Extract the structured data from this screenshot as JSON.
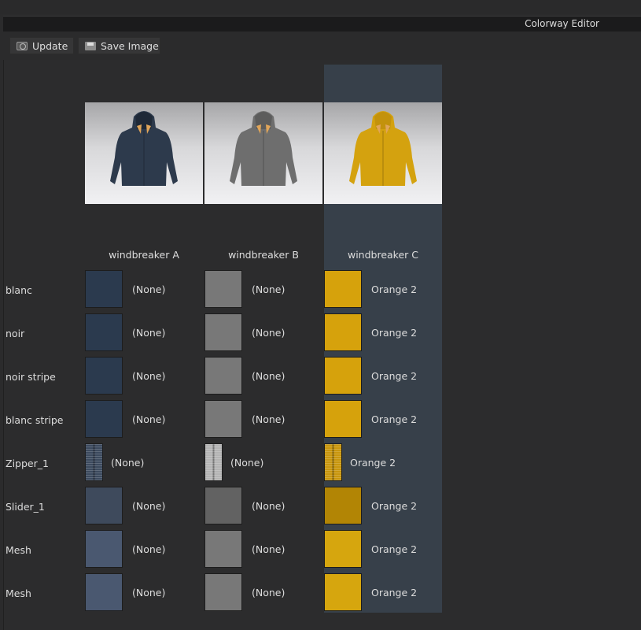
{
  "window": {
    "title": "Colorway Editor"
  },
  "toolbar": {
    "update_label": "Update",
    "save_label": "Save Image"
  },
  "colorways": [
    {
      "name": "windbreaker A",
      "jacket_color": "#2d3a4c",
      "hood_color": "#1f2937"
    },
    {
      "name": "windbreaker B",
      "jacket_color": "#6e6e6e",
      "hood_color": "#5c5c5c"
    },
    {
      "name": "windbreaker C",
      "jacket_color": "#d4a20f",
      "hood_color": "#c3920c"
    }
  ],
  "selected_colorway": "windbreaker C",
  "rows": [
    {
      "label": "blanc",
      "cells": [
        {
          "value": "(None)",
          "color": "#2b3a4e"
        },
        {
          "value": "(None)",
          "color": "#787878"
        },
        {
          "value": "Orange 2",
          "color": "#d6a20c"
        }
      ]
    },
    {
      "label": "noir",
      "cells": [
        {
          "value": "(None)",
          "color": "#2b3a4e"
        },
        {
          "value": "(None)",
          "color": "#787878"
        },
        {
          "value": "Orange 2",
          "color": "#d6a20c"
        }
      ]
    },
    {
      "label": "noir stripe",
      "cells": [
        {
          "value": "(None)",
          "color": "#2b3a4e"
        },
        {
          "value": "(None)",
          "color": "#787878"
        },
        {
          "value": "Orange 2",
          "color": "#d6a20c"
        }
      ]
    },
    {
      "label": "blanc stripe",
      "cells": [
        {
          "value": "(None)",
          "color": "#2b3a4e"
        },
        {
          "value": "(None)",
          "color": "#787878"
        },
        {
          "value": "Orange 2",
          "color": "#d6a20c"
        }
      ]
    },
    {
      "label": "Zipper_1",
      "zipper": true,
      "cells": [
        {
          "value": "(None)",
          "color": "#3c4a5e"
        },
        {
          "value": "(None)",
          "color": "#b4b4b4"
        },
        {
          "value": "Orange 2",
          "color": "#c8960e"
        }
      ]
    },
    {
      "label": "Slider_1",
      "cells": [
        {
          "value": "(None)",
          "color": "#3e4a5c"
        },
        {
          "value": "(None)",
          "color": "#626262"
        },
        {
          "value": "Orange 2",
          "color": "#b28505"
        }
      ]
    },
    {
      "label": "Mesh",
      "cells": [
        {
          "value": "(None)",
          "color": "#4a5870"
        },
        {
          "value": "(None)",
          "color": "#787878"
        },
        {
          "value": "Orange 2",
          "color": "#d6a60e"
        }
      ]
    },
    {
      "label": "Mesh",
      "cells": [
        {
          "value": "(None)",
          "color": "#4a5870"
        },
        {
          "value": "(None)",
          "color": "#787878"
        },
        {
          "value": "Orange 2",
          "color": "#d6a60e"
        }
      ]
    }
  ]
}
